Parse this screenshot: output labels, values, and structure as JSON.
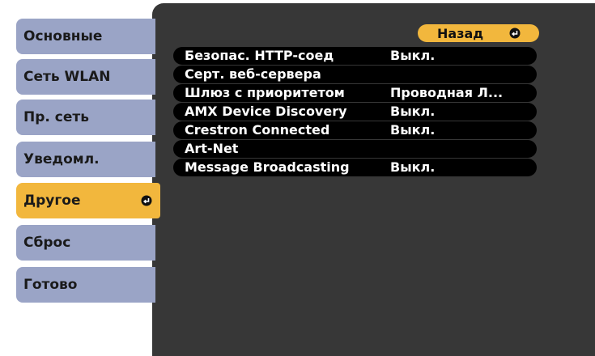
{
  "menu": {
    "tabs": [
      {
        "label": "Основные"
      },
      {
        "label": "Сеть WLAN"
      },
      {
        "label": "Пр. сеть"
      },
      {
        "label": "Уведомл."
      },
      {
        "label": "Другое",
        "active": true
      },
      {
        "label": "Сброс"
      },
      {
        "label": "Готово"
      }
    ]
  },
  "submenu": {
    "back_label": "Назад",
    "rows": [
      {
        "name": "Безопас. HTTP-соед",
        "value": "Выкл."
      },
      {
        "name": "Серт. веб-сервера",
        "value": ""
      },
      {
        "name": "Шлюз с приоритетом",
        "value": "Проводная Л..."
      },
      {
        "name": "AMX Device Discovery",
        "value": "Выкл."
      },
      {
        "name": "Crestron Connected",
        "value": "Выкл."
      },
      {
        "name": "Art-Net",
        "value": ""
      },
      {
        "name": "Message Broadcasting",
        "value": "Выкл."
      }
    ]
  },
  "colors": {
    "tab_inactive": "#9aa4c6",
    "tab_active": "#f2b73d",
    "panel": "#373737",
    "row": "#000000"
  },
  "icons": {
    "enter": "enter-icon"
  }
}
